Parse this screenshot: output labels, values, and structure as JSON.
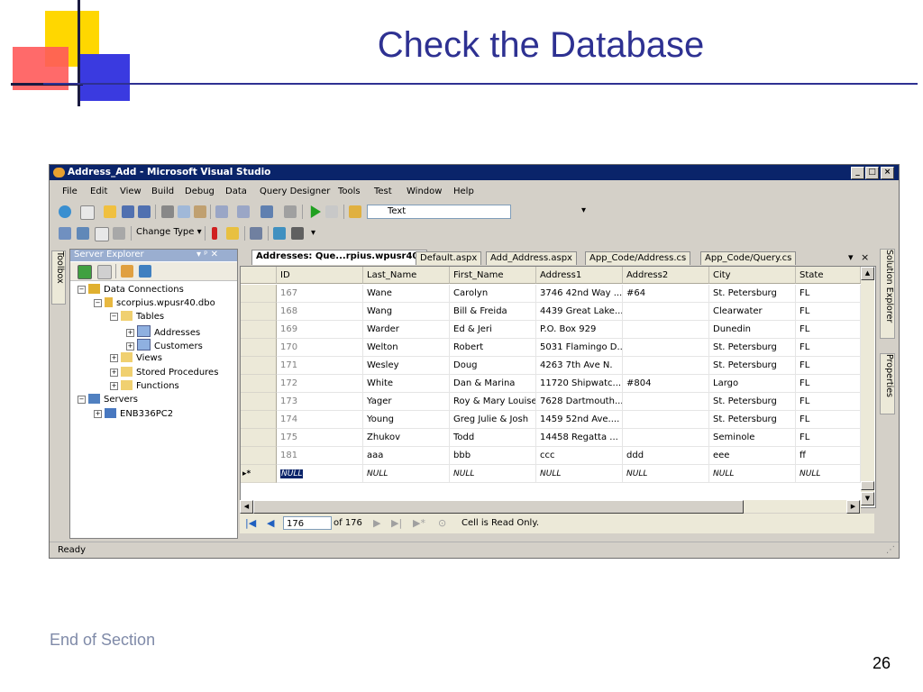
{
  "slide": {
    "title": "Check the Database",
    "footer": "End of Section",
    "page_number": "26"
  },
  "window": {
    "title": "Address_Add - Microsoft Visual Studio",
    "controls": [
      "_",
      "□",
      "×"
    ]
  },
  "menu": [
    "File",
    "Edit",
    "View",
    "Build",
    "Debug",
    "Data",
    "Query Designer",
    "Tools",
    "Test",
    "Window",
    "Help"
  ],
  "toolbar1": {
    "target_combo_value": "Text"
  },
  "toolbar2": {
    "change_type_label": "Change Type ▾"
  },
  "side_tabs": {
    "toolbox": "Toolbox",
    "solution_explorer": "Solution Explorer",
    "properties": "Properties"
  },
  "server_explorer": {
    "title": "Server Explorer",
    "header_controls": "▾ ᵖ ✕",
    "tree": [
      {
        "label": "Data Connections",
        "expander": "−",
        "icon": "data-connections-icon"
      },
      {
        "label": "scorpius.wpusr40.dbo",
        "expander": "−",
        "icon": "database-icon"
      },
      {
        "label": "Tables",
        "expander": "−",
        "icon": "folder-icon"
      },
      {
        "label": "Addresses",
        "expander": "+",
        "icon": "table-icon"
      },
      {
        "label": "Customers",
        "expander": "+",
        "icon": "table-icon"
      },
      {
        "label": "Views",
        "expander": "+",
        "icon": "folder-icon"
      },
      {
        "label": "Stored Procedures",
        "expander": "+",
        "icon": "folder-icon"
      },
      {
        "label": "Functions",
        "expander": "+",
        "icon": "folder-icon"
      },
      {
        "label": "Servers",
        "expander": "−",
        "icon": "servers-icon"
      },
      {
        "label": "ENB336PC2",
        "expander": "+",
        "icon": "computer-icon"
      }
    ]
  },
  "tabs": [
    {
      "label": "Addresses: Que...rpius.wpusr40)",
      "active": true
    },
    {
      "label": "Default.aspx",
      "active": false
    },
    {
      "label": "Add_Address.aspx",
      "active": false
    },
    {
      "label": "App_Code/Address.cs",
      "active": false
    },
    {
      "label": "App_Code/Query.cs",
      "active": false
    }
  ],
  "tab_controls": {
    "dropdown": "▾",
    "close": "×"
  },
  "grid": {
    "columns": [
      "ID",
      "Last_Name",
      "First_Name",
      "Address1",
      "Address2",
      "City",
      "State"
    ],
    "rows": [
      [
        "167",
        "Wane",
        "Carolyn",
        "3746 42nd Way ...",
        "#64",
        "St. Petersburg",
        "FL"
      ],
      [
        "168",
        "Wang",
        "Bill & Freida",
        "4439 Great Lake...",
        "",
        "Clearwater",
        "FL"
      ],
      [
        "169",
        "Warder",
        "Ed & Jeri",
        "P.O. Box 929",
        "",
        "Dunedin",
        "FL"
      ],
      [
        "170",
        "Welton",
        "Robert",
        "5031 Flamingo D...",
        "",
        "St. Petersburg",
        "FL"
      ],
      [
        "171",
        "Wesley",
        "Doug",
        "4263 7th Ave N.",
        "",
        "St. Petersburg",
        "FL"
      ],
      [
        "172",
        "White",
        "Dan & Marina",
        "11720 Shipwatc...",
        "#804",
        "Largo",
        "FL"
      ],
      [
        "173",
        "Yager",
        "Roy & Mary Louise",
        "7628 Dartmouth...",
        "",
        "St. Petersburg",
        "FL"
      ],
      [
        "174",
        "Young",
        "Greg Julie & Josh",
        "1459 52nd Ave....",
        "",
        "St. Petersburg",
        "FL"
      ],
      [
        "175",
        "Zhukov",
        "Todd",
        "14458 Regatta ...",
        "",
        "Seminole",
        "FL"
      ],
      [
        "181",
        "aaa",
        "bbb",
        "ccc",
        "ddd",
        "eee",
        "ff"
      ]
    ],
    "new_row_marker": "▸*",
    "new_row": [
      "NULL",
      "NULL",
      "NULL",
      "NULL",
      "NULL",
      "NULL",
      "NULL"
    ]
  },
  "navigator": {
    "current_record": "176",
    "of_total": "of 176",
    "status": "Cell is Read Only."
  },
  "status_bar": {
    "text": "Ready"
  },
  "colors": {
    "title_blue": "#2e3192",
    "titlebar": "#0a246a"
  }
}
